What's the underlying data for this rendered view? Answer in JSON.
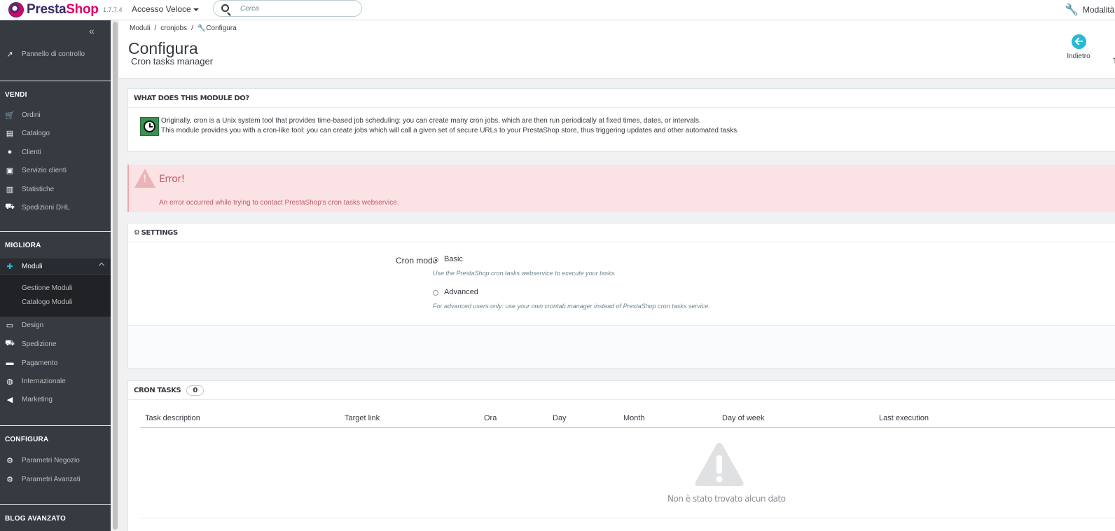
{
  "header": {
    "brand_a": "Presta",
    "brand_b": "Shop",
    "version": "1.7.7.4",
    "quick_access": "Accesso Veloce",
    "search_placeholder": "Cerca",
    "maintenance": "Modalità"
  },
  "sidebar": {
    "dashboard": "Pannello di controllo",
    "sections": {
      "sell": "VENDI",
      "improve": "MIGLIORA",
      "configure": "CONFIGURA",
      "blog": "BLOG AVANZATO"
    },
    "sell_items": [
      "Ordini",
      "Catalogo",
      "Clienti",
      "Servizio clienti",
      "Statistiche",
      "Spedizioni DHL"
    ],
    "modules": "Moduli",
    "modules_sub": [
      "Gestione Moduli",
      "Catalogo Moduli"
    ],
    "improve_items": [
      "Design",
      "Spedizione",
      "Pagamento",
      "Internazionale",
      "Marketing"
    ],
    "configure_items": [
      "Parametri Negozio",
      "Parametri Avanzati"
    ]
  },
  "breadcrumb": [
    "Moduli",
    "cronjobs",
    "Configura"
  ],
  "page": {
    "title": "Configura",
    "subtitle": "Cron tasks manager",
    "back": "Indietro",
    "cut_label": "T"
  },
  "info_panel": {
    "heading": "WHAT DOES THIS MODULE DO?",
    "line1": "Originally, cron is a Unix system tool that provides time-based job scheduling: you can create many cron jobs, which are then run periodically at fixed times, dates, or intervals.",
    "line2": "This module provides you with a cron-like tool: you can create jobs which will call a given set of secure URLs to your PrestaShop store, thus triggering updates and other automated tasks."
  },
  "alert": {
    "title": "Error!",
    "message": "An error occurred while trying to contact PrestaShop's cron tasks webservice."
  },
  "settings": {
    "heading": "SETTINGS",
    "label": "Cron mode",
    "basic": "Basic",
    "basic_help": "Use the PrestaShop cron tasks webservice to execute your tasks.",
    "advanced": "Advanced",
    "advanced_help": "For advanced users only: use your own crontab manager instead of PrestaShop cron tasks service."
  },
  "cron_tasks": {
    "heading": "CRON TASKS",
    "count": "0",
    "columns": [
      "Task description",
      "Target link",
      "Ora",
      "Day",
      "Month",
      "Day of week",
      "Last execution"
    ],
    "empty": "Non è stato trovato alcun dato"
  }
}
